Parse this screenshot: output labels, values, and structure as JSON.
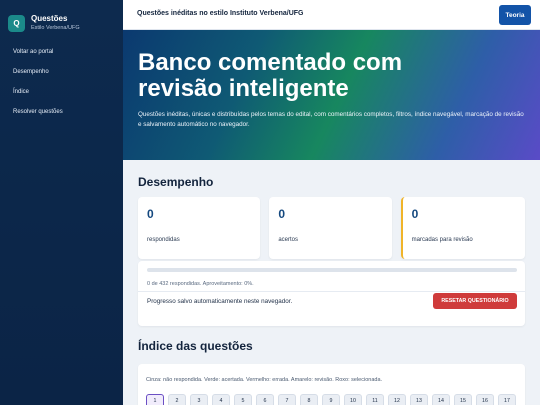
{
  "sidebar": {
    "logo_letter": "Q",
    "title": "Questões",
    "subtitle": "Estilo Verbena/UFG",
    "items": [
      {
        "label": "Voltar ao portal"
      },
      {
        "label": "Desempenho"
      },
      {
        "label": "Índice"
      },
      {
        "label": "Resolver questões"
      }
    ]
  },
  "topbar": {
    "title": "Questões inéditas no estilo Instituto Verbena/UFG",
    "theory_button": "Teoria"
  },
  "hero": {
    "title": "Banco comentado com revisão inteligente",
    "description": "Questões inéditas, únicas e distribuídas pelos temas do edital, com comentários completos, filtros, índice navegável, marcação de revisão e salvamento automático no navegador."
  },
  "performance": {
    "title": "Desempenho",
    "stats": [
      {
        "value": "0",
        "label": "respondidas"
      },
      {
        "value": "0",
        "label": "acertos"
      },
      {
        "value": "0",
        "label": "marcadas para revisão"
      }
    ],
    "progress_fraction": 0,
    "progress_text": "0 de 432 respondidas. Aproveitamento: 0%.",
    "autosave_text": "Progresso salvo automaticamente neste navegador.",
    "reset_button": "RESETAR QUESTIONÁRIO"
  },
  "index": {
    "title": "Índice das questões",
    "legend": "Cinza: não respondida. Verde: acertada. Vermelho: errada. Amarelo: revisão. Roxo: selecionada.",
    "questions": [
      "1",
      "2",
      "3",
      "4",
      "5",
      "6",
      "7",
      "8",
      "9",
      "10",
      "11",
      "12",
      "13",
      "14",
      "15",
      "16",
      "17"
    ],
    "selected": "1"
  },
  "colors": {
    "sidebar_bg": "#0d2a4e",
    "accent": "#1354a8",
    "danger": "#cf3b3b",
    "review": "#f0b429",
    "selected": "#6b4fc4"
  }
}
